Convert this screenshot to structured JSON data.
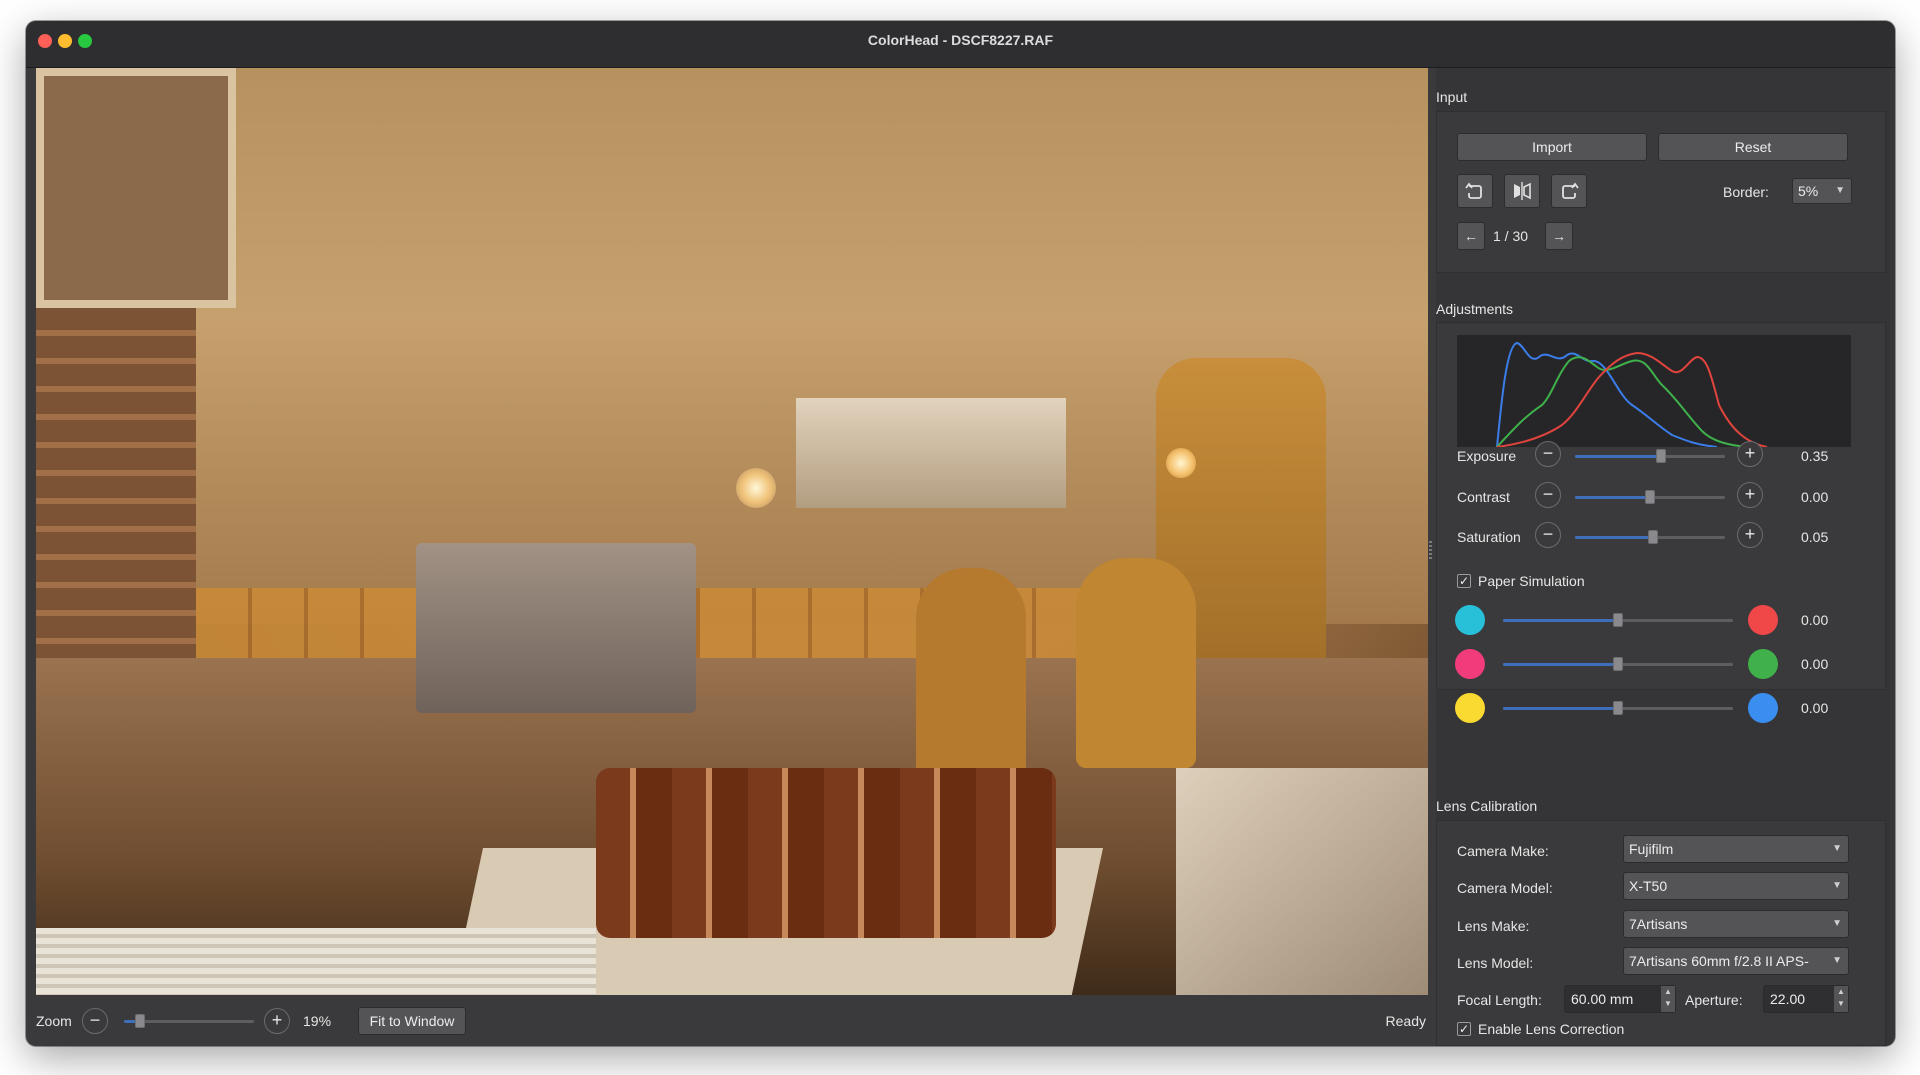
{
  "window": {
    "title": "ColorHead - DSCF8227.RAF"
  },
  "bottom_bar": {
    "zoom_label": "Zoom",
    "zoom_minus": "−",
    "zoom_plus": "+",
    "zoom_value": "19%",
    "zoom_level_fraction": 0.12,
    "fit_to_window": "Fit to Window",
    "status": "Ready"
  },
  "input": {
    "title": "Input",
    "import_label": "Import",
    "reset_label": "Reset",
    "border_label": "Border:",
    "border_value": "5%",
    "prev_icon": "←",
    "next_icon": "→",
    "page_counter": "1 / 30",
    "icons": [
      "rotate-left-icon",
      "flip-horizontal-icon",
      "rotate-right-icon"
    ]
  },
  "adjustments": {
    "title": "Adjustments",
    "histogram_colors": {
      "blue": "#3b7de8",
      "green": "#3fb04a",
      "red": "#e0443d"
    },
    "sliders": [
      {
        "label": "Exposure",
        "value": "0.35",
        "fraction": 0.57
      },
      {
        "label": "Contrast",
        "value": "0.00",
        "fraction": 0.5
      },
      {
        "label": "Saturation",
        "value": "0.05",
        "fraction": 0.52
      }
    ],
    "paper_simulation_label": "Paper Simulation",
    "paper_simulation_checked": true,
    "color_balance": [
      {
        "left_color": "#27c0d8",
        "right_color": "#f04848",
        "value": "0.00",
        "fraction": 0.5
      },
      {
        "left_color": "#f03c7a",
        "right_color": "#3fb04a",
        "value": "0.00",
        "fraction": 0.5
      },
      {
        "left_color": "#fad931",
        "right_color": "#3a8ef0",
        "value": "0.00",
        "fraction": 0.5
      }
    ]
  },
  "lens_calibration": {
    "title": "Lens Calibration",
    "camera_make_label": "Camera Make:",
    "camera_make_value": "Fujifilm",
    "camera_model_label": "Camera Model:",
    "camera_model_value": "X-T50",
    "lens_make_label": "Lens Make:",
    "lens_make_value": "7Artisans",
    "lens_model_label": "Lens Model:",
    "lens_model_value": "7Artisans 60mm f/2.8 II APS-",
    "focal_length_label": "Focal Length:",
    "focal_length_value": "60.00 mm",
    "aperture_label": "Aperture:",
    "aperture_value": "22.00",
    "enable_lens_correction_label": "Enable Lens Correction",
    "enable_lens_correction_checked": true
  }
}
